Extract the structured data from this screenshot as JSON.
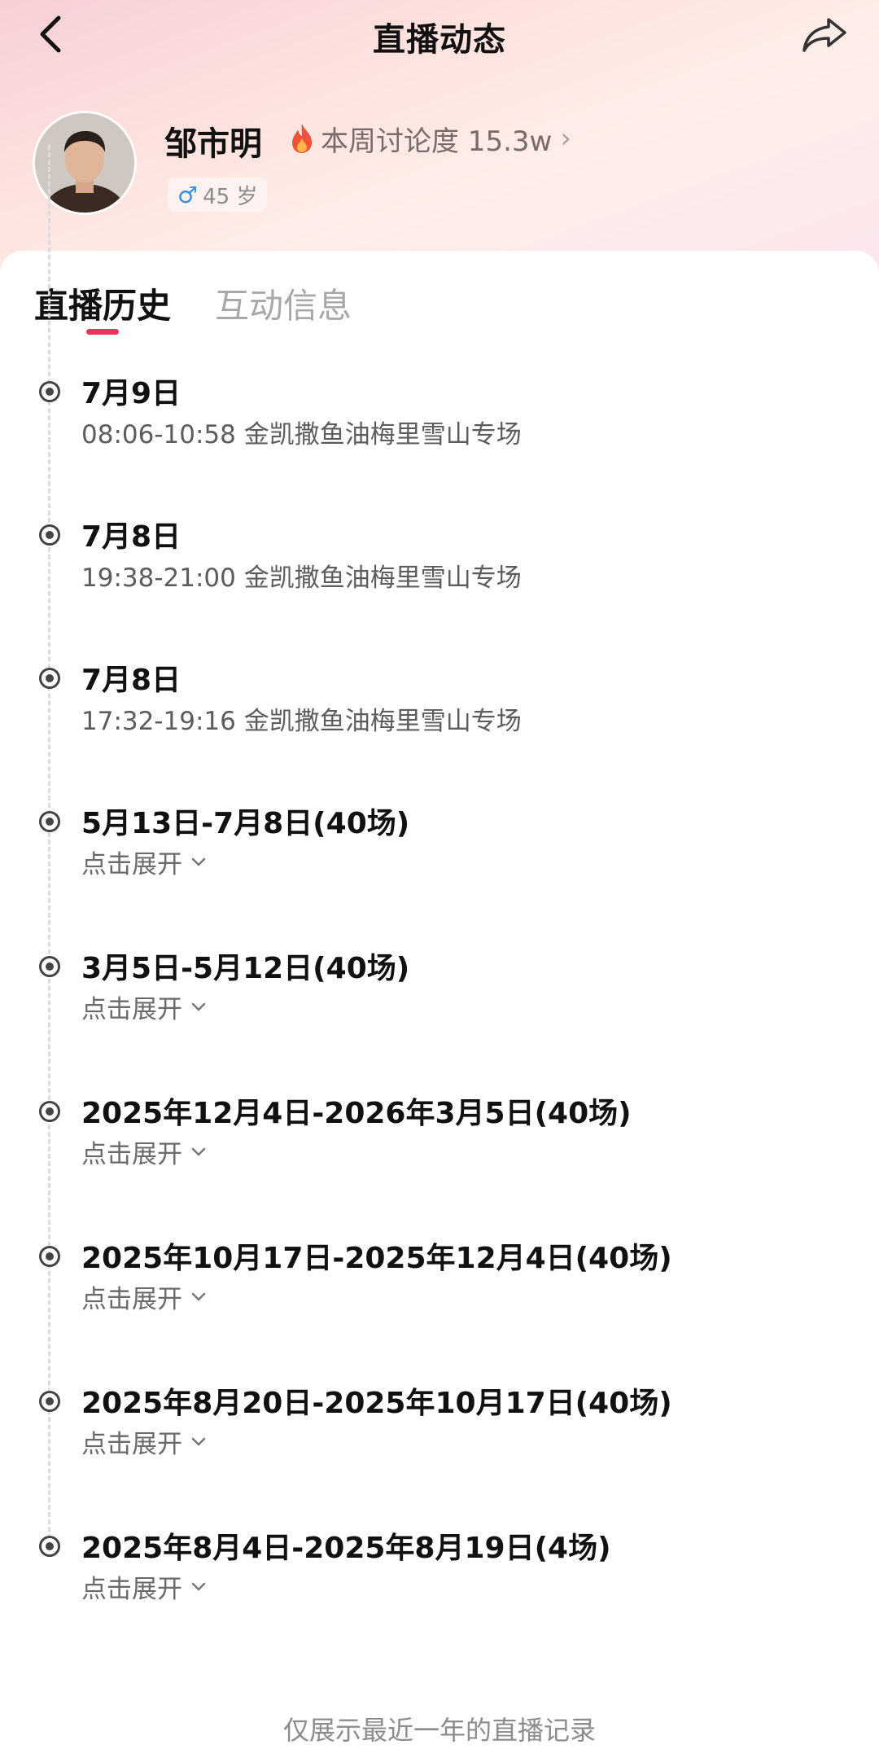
{
  "header": {
    "title": "直播动态"
  },
  "profile": {
    "name": "邹市明",
    "heat": "本周讨论度 15.3w",
    "gender_symbol": "♂",
    "age": "45 岁"
  },
  "tabs": [
    {
      "label": "直播历史",
      "active": true
    },
    {
      "label": "互动信息",
      "active": false
    }
  ],
  "timeline": [
    {
      "title": "7月9日",
      "detail": "08:06-10:58 金凯撒鱼油梅里雪山专场"
    },
    {
      "title": "7月8日",
      "detail": "19:38-21:00 金凯撒鱼油梅里雪山专场"
    },
    {
      "title": "7月8日",
      "detail": "17:32-19:16 金凯撒鱼油梅里雪山专场"
    },
    {
      "title": "5月13日-7月8日(40场)",
      "expand": "点击展开"
    },
    {
      "title": "3月5日-5月12日(40场)",
      "expand": "点击展开"
    },
    {
      "title": "2025年12月4日-2026年3月5日(40场)",
      "expand": "点击展开"
    },
    {
      "title": "2025年10月17日-2025年12月4日(40场)",
      "expand": "点击展开"
    },
    {
      "title": "2025年8月20日-2025年10月17日(40场)",
      "expand": "点击展开"
    },
    {
      "title": "2025年8月4日-2025年8月19日(4场)",
      "expand": "点击展开"
    }
  ],
  "footer_note": "仅展示最近一年的直播记录",
  "colors": {
    "accent": "#e8345a",
    "gender": "#3a8fd8"
  }
}
